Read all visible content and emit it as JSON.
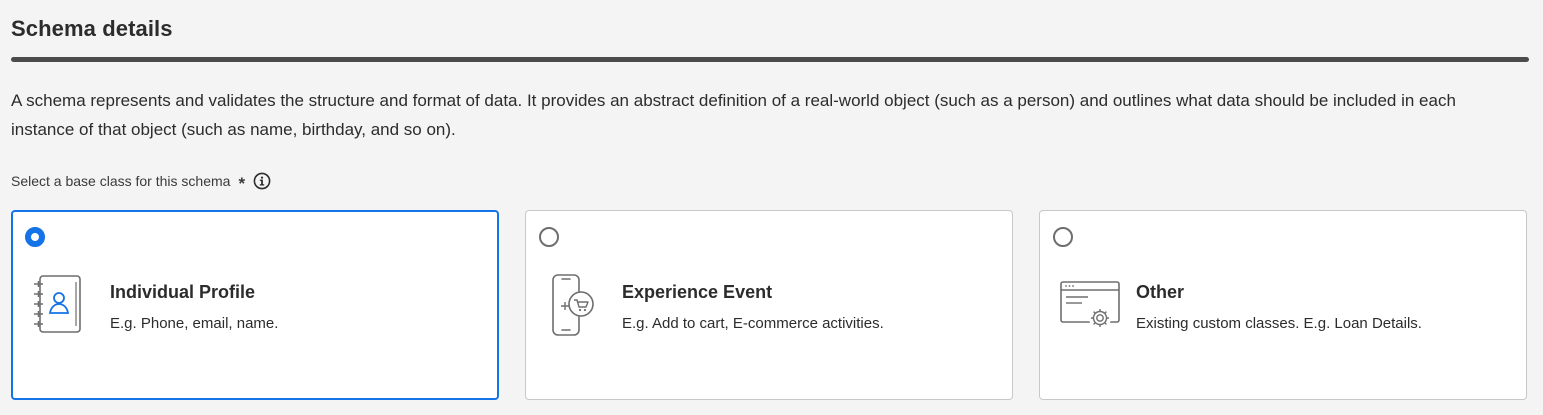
{
  "section": {
    "title": "Schema details",
    "description": "A schema represents and validates the structure and format of data. It provides an abstract definition of a real-world object (such as a person) and outlines what data should be included in each instance of that object (such as name, birthday, and so on).",
    "base_class_label": "Select a base class for this schema",
    "required_marker": "*"
  },
  "options": [
    {
      "title": "Individual Profile",
      "description": "E.g. Phone, email, name.",
      "selected": true,
      "icon": "profile-notebook-icon"
    },
    {
      "title": "Experience Event",
      "description": "E.g. Add to cart, E-commerce activities.",
      "selected": false,
      "icon": "mobile-cart-icon"
    },
    {
      "title": "Other",
      "description": "Existing custom classes. E.g. Loan Details.",
      "selected": false,
      "icon": "browser-gear-icon"
    }
  ],
  "colors": {
    "accent": "#1473e6",
    "heading_rule": "#4b4b4b",
    "background": "#f4f4f4",
    "card_border": "#c8c8c8"
  }
}
